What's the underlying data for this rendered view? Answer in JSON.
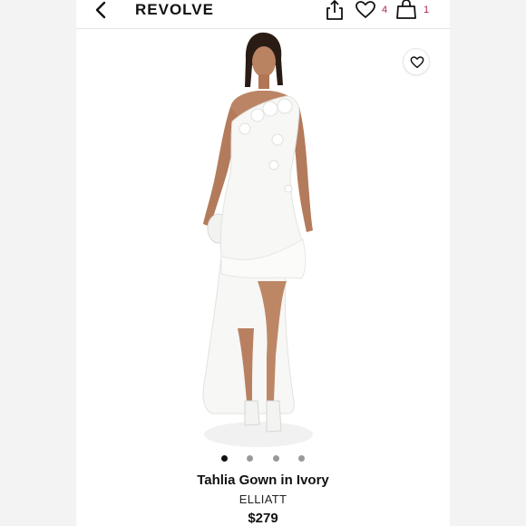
{
  "header": {
    "brand": "REVOLVE",
    "wishlist_count": "4",
    "bag_count": "1"
  },
  "icons": {
    "back": "chevron-left-icon",
    "share": "share-icon",
    "wishlist": "heart-icon",
    "bag": "shopping-bag-icon",
    "favorite": "heart-icon"
  },
  "carousel": {
    "total": 4,
    "active": 1
  },
  "product": {
    "name": "Tahlia Gown in Ivory",
    "brand": "ELLIATT",
    "price": "$279"
  },
  "colors": {
    "accent_count": "#b0225a",
    "text": "#111111"
  }
}
